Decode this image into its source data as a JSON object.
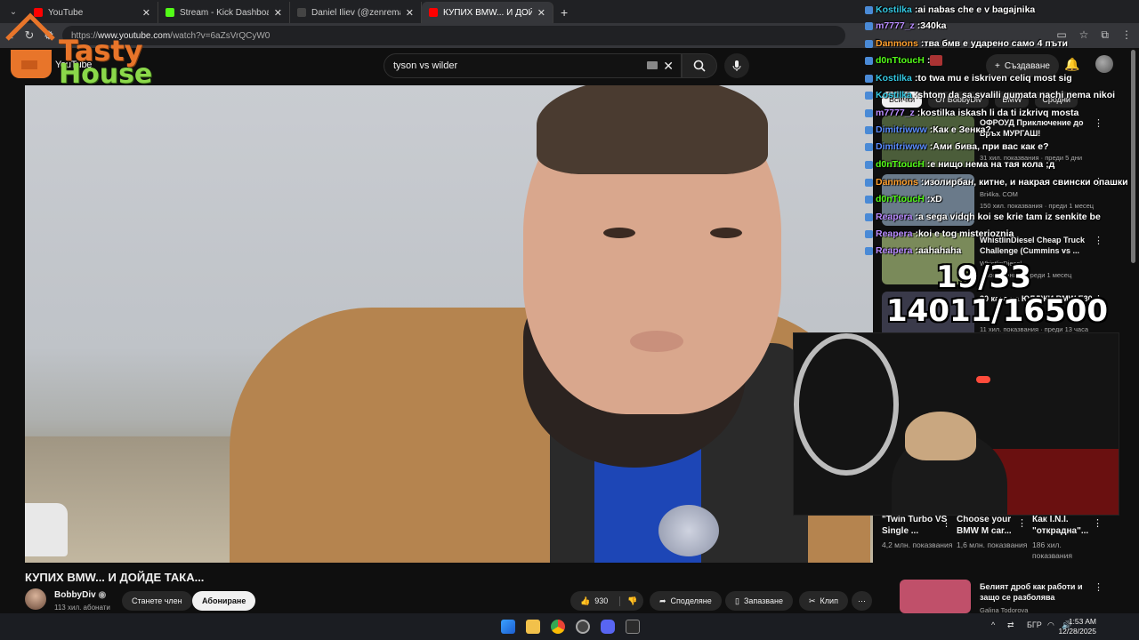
{
  "browser": {
    "tabs": [
      {
        "title": "YouTube",
        "color": "#ff0000",
        "active": false
      },
      {
        "title": "Stream - Kick Dashboard",
        "color": "#53fc18",
        "active": false
      },
      {
        "title": "Daniel Iliev (@zenremasta) | TikTok",
        "color": "#111111",
        "active": false
      },
      {
        "title": "КУПИХ BMW... И ДОЙДЕ ТАКА...",
        "color": "#ff0000",
        "active": true
      }
    ],
    "url_prefix": "https://",
    "url_host": "www.youtube.com",
    "url_path": "/watch?v=6aZsVrQCyW0"
  },
  "youtube": {
    "logo_text": "YouTube",
    "search_value": "tyson vs wilder",
    "create_label": "Създаване"
  },
  "overlay_logo": {
    "line1": "Tasty",
    "line2": "House"
  },
  "video": {
    "title": "КУПИХ BMW... И ДОЙДЕ ТАКА...",
    "channel": "BobbyDiv",
    "subscribers": "113 хил. абонати",
    "join_label": "Станете член",
    "subscribe_label": "Абониране",
    "likes": "930",
    "share_label": "Споделяне",
    "save_label": "Запазване",
    "clip_label": "Клип"
  },
  "chips": [
    "Всички",
    "От BobbyDiv",
    "BMW",
    "Сродни"
  ],
  "recommendations": [
    {
      "title": "ОФРОУД Приключение до Връх МУРГАШ!",
      "channel": "...am",
      "views": "31 хил. показвания · преди 5 дни",
      "thumb": "#4b5d3a"
    },
    {
      "title": "...",
      "channel": "Bri4ka. COM",
      "views": "150 хил. показвания · преди 1 месец",
      "thumb": "#6a7a8a"
    },
    {
      "title": "WhistlinDiesel Cheap Truck Challenge (Cummins vs ...",
      "channel": "WhistlinDiesel",
      "views": "...показвания · преди 1 месец",
      "thumb": "#7a8a5a"
    },
    {
      "title": "30 ката на ЮЛДЖИ BMW E30",
      "channel": "...",
      "views": "11 хил. показвания · преди 13 часа",
      "thumb": "#3a3a4a"
    }
  ],
  "shorts": [
    {
      "title": "\"Twin Turbo VS Single ...",
      "views": "4,2 млн. показвания"
    },
    {
      "title": "Choose your BMW M car...",
      "views": "1,6 млн. показвания"
    },
    {
      "title": "Как I.N.I. \"открадна\"...",
      "views": "186 хил. показвания"
    }
  ],
  "last_rec": {
    "title": "Белият дроб как работи и защо се разболява",
    "channel": "Galina Todorova"
  },
  "chat": [
    {
      "user": "Kostilka",
      "text": "ai nabas che e v bagajnika",
      "color": "#33c6e0"
    },
    {
      "user": "m7777_z",
      "text": "340ka",
      "color": "#b98cff"
    },
    {
      "user": "Danmons",
      "text": "тва бмв е ударено само 4 пъти",
      "color": "#ff9f2e"
    },
    {
      "user": "d0nTtoucH",
      "text": "",
      "color": "#53fc18"
    },
    {
      "user": "Kostilka",
      "text": "to twa mu e iskriven celiq most sig",
      "color": "#33c6e0"
    },
    {
      "user": "Kostilka",
      "text": "shtom da sa svalili gumata nachi nema nikoi",
      "color": "#33c6e0"
    },
    {
      "user": "m7777_z",
      "text": "kostilka iskash li da ti izkrivq mosta",
      "color": "#b98cff"
    },
    {
      "user": "Dimitriwww",
      "text": "Как е Зенка?",
      "color": "#5a8cff"
    },
    {
      "user": "Dimitriwww",
      "text": "Ами бива, при вас как е?",
      "color": "#5a8cff"
    },
    {
      "user": "d0nTtoucH",
      "text": "е нищо нема на тая кола ;д",
      "color": "#53fc18"
    },
    {
      "user": "Danmons",
      "text": "изолирбан, китне, и накрая свински опашки",
      "color": "#ff9f2e"
    },
    {
      "user": "d0nTtoucH",
      "text": "хD",
      "color": "#53fc18"
    },
    {
      "user": "Reapera",
      "text": "a sega vidqh koi se krie tam iz senkite be",
      "color": "#b98cff"
    },
    {
      "user": "Reapera",
      "text": "koi e tog misterioznia",
      "color": "#b98cff"
    },
    {
      "user": "Reapera",
      "text": "aahahaha",
      "color": "#b98cff"
    }
  ],
  "counters": {
    "goal1": "19/33",
    "goal2": "14011/16500"
  },
  "taskbar": {
    "lang": "БГР",
    "time": "1:53 AM",
    "date": "12/28/2025"
  }
}
